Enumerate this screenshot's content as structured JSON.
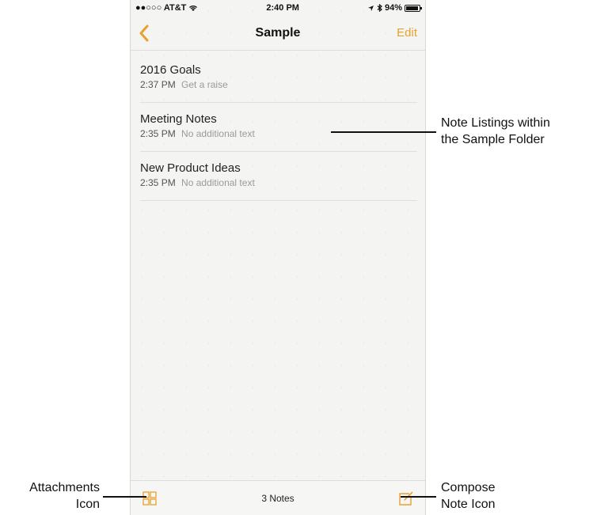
{
  "status_bar": {
    "carrier": "●●○○○ AT&T",
    "time": "2:40 PM",
    "battery": "94%"
  },
  "nav": {
    "title": "Sample",
    "edit_label": "Edit"
  },
  "notes": [
    {
      "title": "2016 Goals",
      "time": "2:37 PM",
      "preview": "Get a raise"
    },
    {
      "title": "Meeting Notes",
      "time": "2:35 PM",
      "preview": "No additional text"
    },
    {
      "title": "New Product Ideas",
      "time": "2:35 PM",
      "preview": "No additional text"
    }
  ],
  "toolbar": {
    "count": "3 Notes"
  },
  "callouts": {
    "note_listings": [
      "Note Listings within",
      "the Sample Folder"
    ],
    "attachments": [
      "Attachments",
      "Icon"
    ],
    "compose": [
      "Compose",
      "Note Icon"
    ]
  },
  "colors": {
    "accent": "#e8a12c"
  },
  "icons": {
    "back": "chevron-left-icon",
    "attachments": "grid-icon",
    "compose": "compose-icon"
  }
}
